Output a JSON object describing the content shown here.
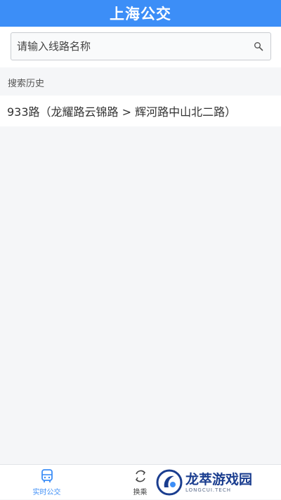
{
  "header": {
    "title": "上海公交"
  },
  "search": {
    "placeholder": "请输入线路名称"
  },
  "history": {
    "label": "搜索历史",
    "items": [
      "933路（龙耀路云锦路 > 辉河路中山北二路）"
    ]
  },
  "bottom_nav": {
    "items": [
      {
        "label": "实时公交",
        "icon": "bus-icon",
        "active": true
      },
      {
        "label": "换乘",
        "icon": "transfer-icon",
        "active": false
      }
    ]
  },
  "watermark": {
    "title": "龙萃游戏园",
    "subtitle": "LONGCUI.TECH"
  },
  "colors": {
    "primary": "#3c8ef7",
    "background": "#f5f6f8"
  }
}
